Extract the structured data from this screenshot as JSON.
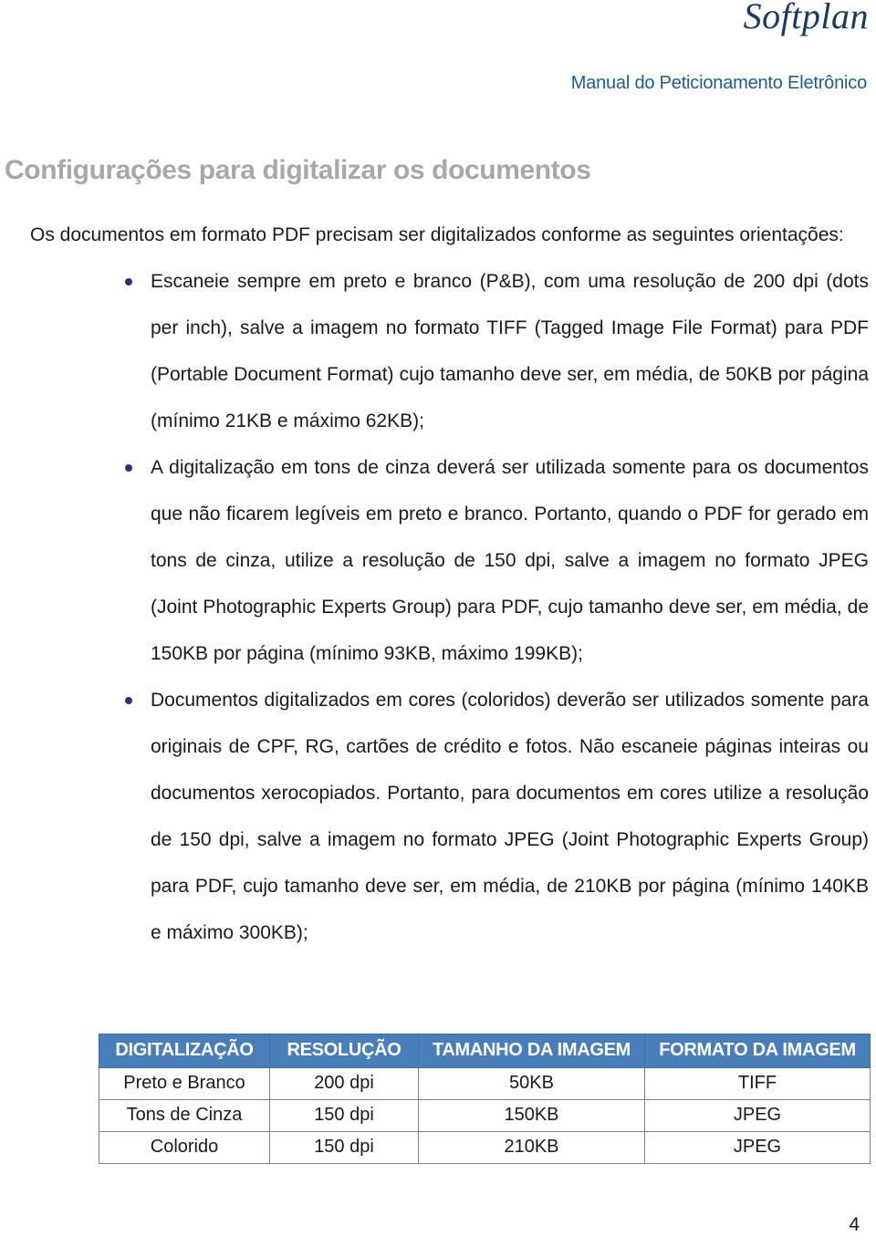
{
  "header": {
    "logo_text": "Softplan",
    "manual_title": "Manual do Peticionamento Eletrônico"
  },
  "section": {
    "title": "Configurações para digitalizar os documentos",
    "intro": "Os documentos em formato PDF precisam ser digitalizados conforme as seguintes orientações:"
  },
  "bullets": [
    {
      "text": "Escaneie sempre em preto e branco (P&B), com uma resolução de 200 dpi (dots per inch), salve a imagem no formato TIFF (Tagged Image File Format) para PDF (Portable Document Format) cujo tamanho deve ser, em média, de 50KB por página (mínimo 21KB e máximo 62KB);"
    },
    {
      "text": "A digitalização em tons de cinza deverá ser utilizada somente para os documentos que não ficarem legíveis em preto e branco. Portanto, quando o PDF for gerado em tons de cinza, utilize a resolução de 150 dpi, salve a imagem no formato JPEG (Joint Photographic Experts Group) para PDF, cujo tamanho deve ser, em média, de 150KB por página (mínimo 93KB, máximo 199KB);"
    },
    {
      "text": "Documentos digitalizados em cores (coloridos) deverão ser utilizados somente para originais de CPF, RG, cartões de crédito e fotos. Não escaneie páginas inteiras ou documentos xerocopiados. Portanto, para documentos em cores utilize a resolução de 150 dpi, salve a imagem no formato JPEG (Joint Photographic Experts Group) para PDF, cujo tamanho deve ser, em média, de 210KB por página (mínimo 140KB e máximo 300KB);"
    }
  ],
  "spec_table": {
    "headers": [
      "DIGITALIZAÇÃO",
      "RESOLUÇÃO",
      "TAMANHO DA IMAGEM",
      "FORMATO DA IMAGEM"
    ],
    "rows": [
      [
        "Preto e Branco",
        "200 dpi",
        "50KB",
        "TIFF"
      ],
      [
        "Tons de Cinza",
        "150 dpi",
        "150KB",
        "JPEG"
      ],
      [
        "Colorido",
        "150 dpi",
        "210KB",
        "JPEG"
      ]
    ]
  },
  "footer": {
    "page_number": "4"
  },
  "colors": {
    "brand_navy": "#1b3a5c",
    "manual_blue": "#1f5c8b",
    "title_gray": "#a8a8a8",
    "table_header_blue": "#4a7ebb",
    "bullet_navy": "#2e2e86"
  }
}
